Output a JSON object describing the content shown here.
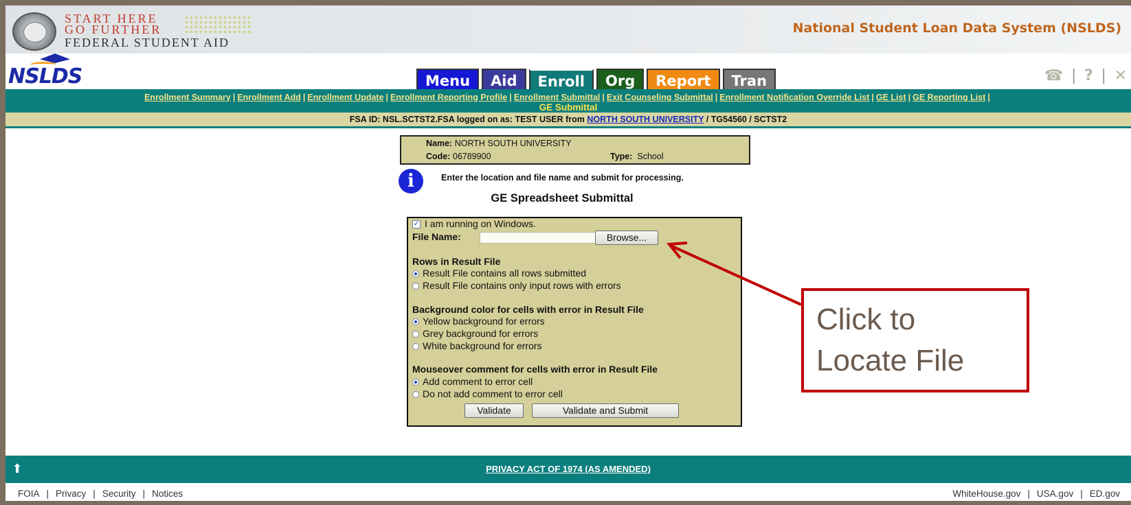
{
  "header": {
    "fsa_line1": "START HERE",
    "fsa_line2": "GO FURTHER",
    "fsa_line3": "FEDERAL STUDENT AID",
    "system_title": "National Student Loan Data System (NSLDS)",
    "logo_text": "NSLDS"
  },
  "nav": {
    "tabs": [
      {
        "label": "Menu",
        "color": "#1717d6"
      },
      {
        "label": "Aid",
        "color": "#3a3a9c"
      },
      {
        "label": "Enroll",
        "color": "#0f7a78"
      },
      {
        "label": "Org",
        "color": "#1c5f1c"
      },
      {
        "label": "Report",
        "color": "#f08a12"
      },
      {
        "label": "Tran",
        "color": "#777777"
      }
    ],
    "tools": [
      "phone-icon",
      "help-icon",
      "close-icon"
    ]
  },
  "subnav": {
    "links": [
      "Enrollment Summary",
      "Enrollment Add",
      "Enrollment Update",
      "Enrollment Reporting Profile",
      "Enrollment Submittal",
      "Exit Counseling Submittal",
      "Enrollment Notification Override List",
      "GE List",
      "GE Reporting List"
    ],
    "current_page": "GE Submittal"
  },
  "session": {
    "prefix": "FSA ID: NSL.SCTST2.FSA logged on as: TEST USER from ",
    "school_link": "NORTH SOUTH UNIVERSITY",
    "suffix": " / TG54560 / SCTST2"
  },
  "org": {
    "name_label": "Name:",
    "name_value": "NORTH SOUTH UNIVERSITY",
    "code_label": "Code:",
    "code_value": "06789900",
    "type_label": "Type:",
    "type_value": "School"
  },
  "instruction": "Enter the location and file name and submit for processing.",
  "page_title": "GE Spreadsheet Submittal",
  "form": {
    "windows_checkbox": {
      "label": "I am running on Windows.",
      "checked": true
    },
    "file_name_label": "File Name:",
    "file_name_value": "",
    "browse_label": "Browse...",
    "rows_header": "Rows in Result File",
    "rows_options": [
      {
        "label": "Result File contains all rows submitted",
        "selected": true
      },
      {
        "label": "Result File contains only input rows with errors",
        "selected": false
      }
    ],
    "bg_header": "Background color for cells with error in Result File",
    "bg_options": [
      {
        "label": "Yellow background for errors",
        "selected": true
      },
      {
        "label": "Grey background for errors",
        "selected": false
      },
      {
        "label": "White background for errors",
        "selected": false
      }
    ],
    "comment_header": "Mouseover comment for cells with error in Result File",
    "comment_options": [
      {
        "label": "Add comment to error cell",
        "selected": true
      },
      {
        "label": "Do not add comment to error cell",
        "selected": false
      }
    ],
    "validate_label": "Validate",
    "validate_submit_label": "Validate and Submit"
  },
  "footer": {
    "privacy_link": "PRIVACY ACT OF 1974 (AS AMENDED)",
    "left_links": [
      "FOIA",
      "Privacy",
      "Security",
      "Notices"
    ],
    "right_links": [
      "WhiteHouse.gov",
      "USA.gov",
      "ED.gov"
    ]
  },
  "annotation": {
    "line1": "Click to",
    "line2": "Locate File",
    "color": "#c00000"
  }
}
